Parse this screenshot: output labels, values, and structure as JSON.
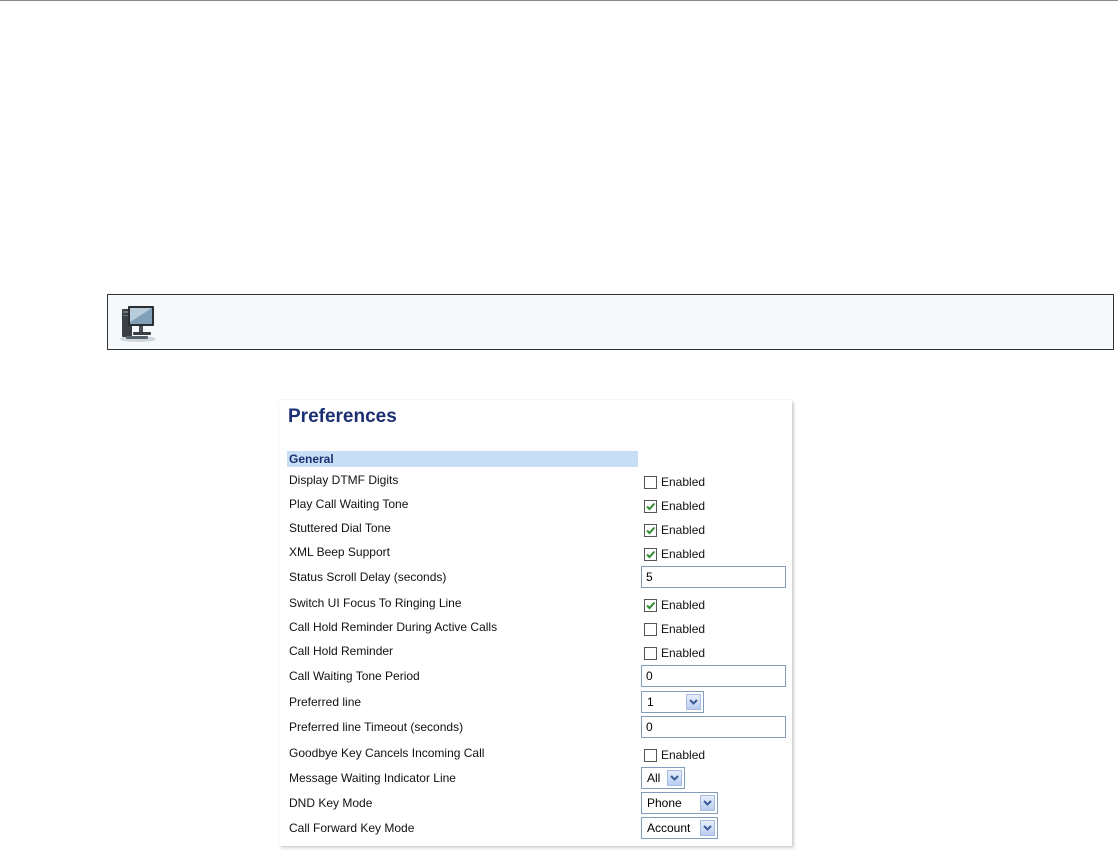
{
  "panel": {
    "title": "Preferences",
    "section": "General"
  },
  "icons": {
    "banner_icon": "web-ui-computer-icon",
    "check": "checkmark-icon",
    "dropdown": "chevron-down-icon"
  },
  "colors": {
    "title": "#1d2f73",
    "section_bar": "#c7def4",
    "check": "#2e8b2e"
  },
  "settings": {
    "display_dtmf_digits": {
      "label": "Display DTMF Digits",
      "option": "Enabled",
      "checked": false
    },
    "play_call_waiting_tone": {
      "label": "Play Call Waiting Tone",
      "option": "Enabled",
      "checked": true
    },
    "stuttered_dial_tone": {
      "label": "Stuttered Dial Tone",
      "option": "Enabled",
      "checked": true
    },
    "xml_beep_support": {
      "label": "XML Beep Support",
      "option": "Enabled",
      "checked": true
    },
    "status_scroll_delay": {
      "label": "Status Scroll Delay (seconds)",
      "value": "5"
    },
    "switch_ui_focus": {
      "label": "Switch UI Focus To Ringing Line",
      "option": "Enabled",
      "checked": true
    },
    "call_hold_reminder_active": {
      "label": "Call Hold Reminder During Active Calls",
      "option": "Enabled",
      "checked": false
    },
    "call_hold_reminder": {
      "label": "Call Hold Reminder",
      "option": "Enabled",
      "checked": false
    },
    "call_waiting_tone_period": {
      "label": "Call Waiting Tone Period",
      "value": "0"
    },
    "preferred_line": {
      "label": "Preferred line",
      "value": "1"
    },
    "preferred_line_timeout": {
      "label": "Preferred line Timeout (seconds)",
      "value": "0"
    },
    "goodbye_key_cancels": {
      "label": "Goodbye Key Cancels Incoming Call",
      "option": "Enabled",
      "checked": false
    },
    "mwi_line": {
      "label": "Message Waiting Indicator Line",
      "value": "All"
    },
    "dnd_key_mode": {
      "label": "DND Key Mode",
      "value": "Phone"
    },
    "call_forward_key_mode": {
      "label": "Call Forward Key Mode",
      "value": "Account"
    }
  }
}
